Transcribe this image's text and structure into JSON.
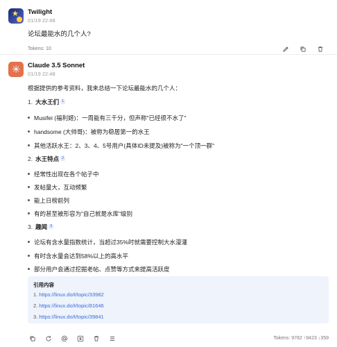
{
  "user_message": {
    "name": "Twilight",
    "time": "01/19 22:48",
    "text": "论坛最能水的几个人?",
    "tokens": "Tokens: 10"
  },
  "assistant_message": {
    "name": "Claude 3.5 Sonnet",
    "time": "01/19 22:48",
    "intro": "根据提供的参考资料，我来总结一下论坛最能水的几个人：",
    "sections": [
      {
        "num": "1.",
        "title": "大水王们",
        "cite": "1",
        "bullets": [
          "Musifei (福利姬)：一周能有三千分，但声称\"已经很不水了\"",
          "handsome (大帅哥)：被称为稳居第一的水王",
          "其他活跃水王：2、3、4、5号用户(具体ID未提及)被称为\"一个顶一群\""
        ]
      },
      {
        "num": "2.",
        "title": "水王特点",
        "cite": "2",
        "bullets": [
          "经常性出现在各个帖子中",
          "发帖量大，互动频繁",
          "能上日榜前列",
          "有的甚至被形容为\"自己就是水库\"级别"
        ]
      },
      {
        "num": "3.",
        "title": "趣闻",
        "cite": "3",
        "bullets": [
          "论坛有含水量指数统计，当超过35%时就需要控制大水漫灌",
          "有时含水量会达到58%以上的高水平",
          "部分用户会通过挖掘老帖、点赞等方式来提高活跃度"
        ]
      }
    ],
    "references": {
      "title": "引用内容",
      "items": [
        {
          "num": "1.",
          "url": "https://linux.do/t/topic/33982"
        },
        {
          "num": "2.",
          "url": "https://linux.do/t/topic/81646"
        },
        {
          "num": "3.",
          "url": "https://linux.do/t/topic/39841"
        }
      ]
    },
    "tokens": "Tokens: 9782 ↑9423 ↓359"
  },
  "icons": {
    "user_actions": [
      "edit-icon",
      "copy-icon",
      "delete-icon"
    ],
    "assistant_actions": [
      "copy-icon",
      "regenerate-icon",
      "mention-icon",
      "translate-icon",
      "delete-icon",
      "more-icon"
    ]
  },
  "colors": {
    "claude_avatar": "#e2714c",
    "link": "#3a6bd6",
    "reference_bg": "#eef3fc"
  }
}
